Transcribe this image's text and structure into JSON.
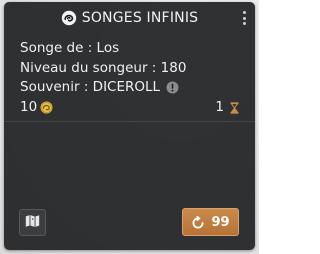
{
  "panel": {
    "title": "SONGES INFINIS",
    "title_icon": "swirl-icon",
    "menu_icon": "kebab-menu-icon",
    "accent_color": "#c98a4a",
    "background_color": "#1a1c1e"
  },
  "info": {
    "dreamer": "Songe de : Los",
    "dreamer_level": "Niveau du songeur : 180",
    "memory": "Souvenir : DICEROLL",
    "memory_icon": "warning-icon"
  },
  "stats": {
    "tokens": "10",
    "tokens_icon": "gold-swirl-coin-icon",
    "turns": "1",
    "turns_icon": "hourglass-icon"
  },
  "footer": {
    "map_icon": "map-icon",
    "action_icon": "refresh-swirl-icon",
    "action_value": "99"
  }
}
